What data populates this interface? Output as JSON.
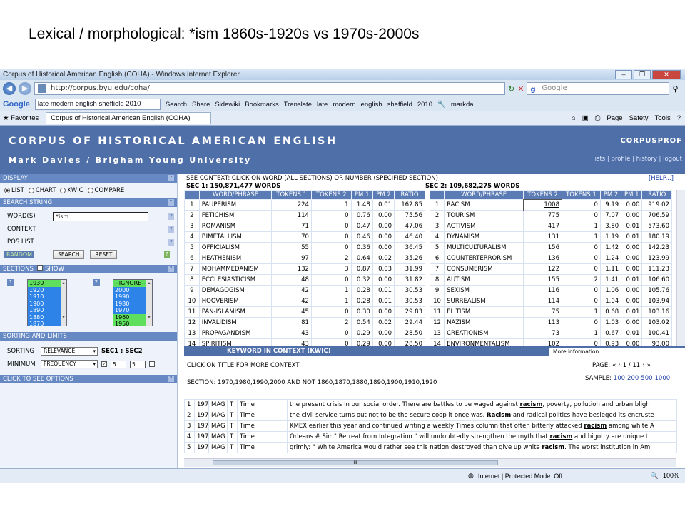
{
  "slide_title": "Lexical / morphological:  *ism  1860s-1920s vs 1970s-2000s",
  "window": {
    "title": "Corpus of Historical American English (COHA) - Windows Internet Explorer",
    "url": "http://corpus.byu.edu/coha/",
    "search_placeholder": "Google"
  },
  "toolbar": {
    "google": "Google",
    "query": "late modern english sheffield 2010",
    "search": "Search",
    "share": "Share",
    "sidewiki": "Sidewiki",
    "bookmarks": "Bookmarks",
    "translate": "Translate",
    "late": "late",
    "modern": "modern",
    "english": "english",
    "sheffield": "sheffield",
    "y2010": "2010",
    "user": "markda..."
  },
  "favbar": {
    "favorites": "Favorites",
    "tab": "Corpus of Historical American English (COHA)",
    "page": "Page",
    "safety": "Safety",
    "tools": "Tools"
  },
  "banner": {
    "title": "CORPUS OF HISTORICAL AMERICAN ENGLISH",
    "author": "Mark Davies / Brigham Young University",
    "corner": "CORPUSPROF",
    "links": "lists | profile | history | logout"
  },
  "left": {
    "display": "DISPLAY",
    "list": "LIST",
    "chart": "CHART",
    "kwic": "KWIC",
    "compare": "COMPARE",
    "search_string": "SEARCH STRING",
    "words_label": "WORD(S)",
    "words_value": "*ism",
    "context": "CONTEXT",
    "poslist": "POS LIST",
    "random": "RANDOM",
    "search_btn": "SEARCH",
    "reset_btn": "RESET",
    "sections": "SECTIONS",
    "show": "SHOW",
    "sec1_num": "1",
    "sec2_num": "2",
    "sec1_items": [
      "1930",
      "1920",
      "1910",
      "1900",
      "1890",
      "1880",
      "1870"
    ],
    "sec2_items": [
      "--IGNORE--",
      "2000",
      "1990",
      "1980",
      "1970",
      "1960",
      "1950"
    ],
    "sorting_limits": "SORTING AND LIMITS",
    "sorting": "SORTING",
    "sort_value": "RELEVANCE",
    "sec_label": "SEC1 : SEC2",
    "minimum": "MINIMUM",
    "min_value": "FREQUENCY",
    "min1": "5",
    "min2": "5",
    "options": "CLICK TO SEE OPTIONS"
  },
  "context_line": "SEE CONTEXT: CLICK ON WORD (ALL SECTIONS) OR NUMBER (SPECIFIED SECTION)",
  "help": "[HELP...]",
  "sec1_head": "SEC 1: 150,871,477 WORDS",
  "sec2_head": "SEC 2: 109,682,275 WORDS",
  "sec1_cols": [
    "",
    "WORD/PHRASE",
    "TOKENS 1",
    "TOKENS 2",
    "PM 1",
    "PM 2",
    "RATIO"
  ],
  "sec2_cols": [
    "",
    "WORD/PHRASE",
    "TOKENS 2",
    "TOKENS 1",
    "PM 2",
    "PM 1",
    "RATIO"
  ],
  "sec1_rows": [
    [
      "1",
      "PAUPERISM",
      "224",
      "1",
      "1.48",
      "0.01",
      "162.85"
    ],
    [
      "2",
      "FETICHISM",
      "114",
      "0",
      "0.76",
      "0.00",
      "75.56"
    ],
    [
      "3",
      "ROMANISM",
      "71",
      "0",
      "0.47",
      "0.00",
      "47.06"
    ],
    [
      "4",
      "BIMETALLISM",
      "70",
      "0",
      "0.46",
      "0.00",
      "46.40"
    ],
    [
      "5",
      "OFFICIALISM",
      "55",
      "0",
      "0.36",
      "0.00",
      "36.45"
    ],
    [
      "6",
      "HEATHENISM",
      "97",
      "2",
      "0.64",
      "0.02",
      "35.26"
    ],
    [
      "7",
      "MOHAMMEDANISM",
      "132",
      "3",
      "0.87",
      "0.03",
      "31.99"
    ],
    [
      "8",
      "ECCLESIASTICISM",
      "48",
      "0",
      "0.32",
      "0.00",
      "31.82"
    ],
    [
      "9",
      "DEMAGOGISM",
      "42",
      "1",
      "0.28",
      "0.01",
      "30.53"
    ],
    [
      "10",
      "HOOVERISM",
      "42",
      "1",
      "0.28",
      "0.01",
      "30.53"
    ],
    [
      "11",
      "PAN-ISLAMISM",
      "45",
      "0",
      "0.30",
      "0.00",
      "29.83"
    ],
    [
      "12",
      "INVALIDISM",
      "81",
      "2",
      "0.54",
      "0.02",
      "29.44"
    ],
    [
      "13",
      "PROPAGANDISM",
      "43",
      "0",
      "0.29",
      "0.00",
      "28.50"
    ],
    [
      "14",
      "SPIRITISM",
      "43",
      "0",
      "0.29",
      "0.00",
      "28.50"
    ]
  ],
  "sec2_rows": [
    [
      "1",
      "RACISM",
      "1008",
      "0",
      "9.19",
      "0.00",
      "919.02"
    ],
    [
      "2",
      "TOURISM",
      "775",
      "0",
      "7.07",
      "0.00",
      "706.59"
    ],
    [
      "3",
      "ACTIVISM",
      "417",
      "1",
      "3.80",
      "0.01",
      "573.60"
    ],
    [
      "4",
      "DYNAMISM",
      "131",
      "1",
      "1.19",
      "0.01",
      "180.19"
    ],
    [
      "5",
      "MULTICULTURALISM",
      "156",
      "0",
      "1.42",
      "0.00",
      "142.23"
    ],
    [
      "6",
      "COUNTERTERRORISM",
      "136",
      "0",
      "1.24",
      "0.00",
      "123.99"
    ],
    [
      "7",
      "CONSUMERISM",
      "122",
      "0",
      "1.11",
      "0.00",
      "111.23"
    ],
    [
      "8",
      "AUTISM",
      "155",
      "2",
      "1.41",
      "0.01",
      "106.60"
    ],
    [
      "9",
      "SEXISM",
      "116",
      "0",
      "1.06",
      "0.00",
      "105.76"
    ],
    [
      "10",
      "SURREALISM",
      "114",
      "0",
      "1.04",
      "0.00",
      "103.94"
    ],
    [
      "11",
      "ELITISM",
      "75",
      "1",
      "0.68",
      "0.01",
      "103.16"
    ],
    [
      "12",
      "NAZISM",
      "113",
      "0",
      "1.03",
      "0.00",
      "103.02"
    ],
    [
      "13",
      "CREATIONISM",
      "73",
      "1",
      "0.67",
      "0.01",
      "100.41"
    ],
    [
      "14",
      "ENVIRONMENTALISM",
      "102",
      "0",
      "0.93",
      "0.00",
      "93.00"
    ]
  ],
  "kwic": {
    "bar": "KEYWORD IN CONTEXT (KWIC)",
    "more": "More information...",
    "click_title": "CLICK ON TITLE FOR MORE CONTEXT",
    "section": "SECTION: 1970,1980,1990,2000 AND NOT 1860,1870,1880,1890,1900,1910,1920",
    "page_label": "PAGE:",
    "page_value": "1 / 11",
    "sample_label": "SAMPLE:",
    "samples": [
      "100",
      "200",
      "500",
      "1000"
    ],
    "rows": [
      {
        "n": "1",
        "year": "1970",
        "genre": "MAG",
        "src": "T",
        "title": "Time",
        "pre": "the present crisis in our social order. There are battles to be waged against ",
        "kw": "racism",
        "post": ", poverty, pollution and urban bligh"
      },
      {
        "n": "2",
        "year": "1970",
        "genre": "MAG",
        "src": "T",
        "title": "Time",
        "pre": "the civil service turns out not to be the secure coop it once was. ",
        "kw": "Racism",
        "post": " and radical politics have besieged its encruste"
      },
      {
        "n": "3",
        "year": "1970",
        "genre": "MAG",
        "src": "T",
        "title": "Time",
        "pre": "KMEX earlier this year and continued writing a weekly Times column that often bitterly attacked ",
        "kw": "racism",
        "post": " among white A"
      },
      {
        "n": "4",
        "year": "1970",
        "genre": "MAG",
        "src": "T",
        "title": "Time",
        "pre": "Orleans # Sir: \" Retreat from Integration \" will undoubtedly strengthen the myth that ",
        "kw": "racism",
        "post": " and bigotry are unique t"
      },
      {
        "n": "5",
        "year": "1970",
        "genre": "MAG",
        "src": "T",
        "title": "Time",
        "pre": "grimly: \" White America would rather see this nation destroyed than give up white ",
        "kw": "racism",
        "post": ". The worst institution in Am"
      }
    ]
  },
  "status": {
    "zone": "Internet | Protected Mode: Off",
    "zoom": "100%"
  }
}
